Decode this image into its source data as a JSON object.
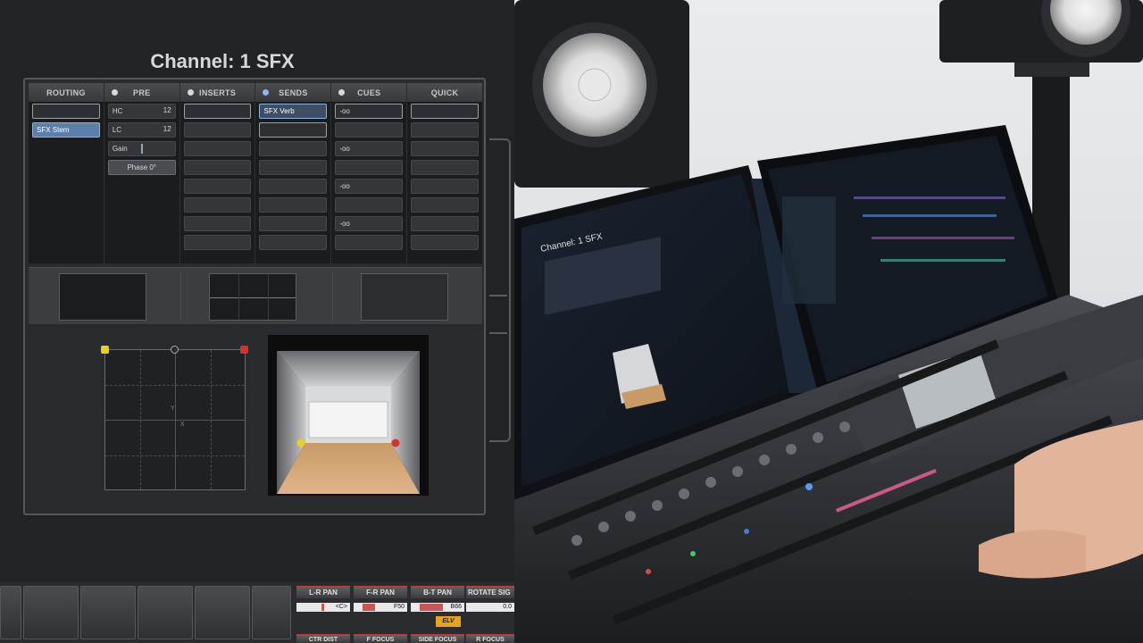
{
  "channel": {
    "title": "Channel: 1 SFX"
  },
  "tabs": [
    {
      "label": "ROUTING",
      "dot": "none"
    },
    {
      "label": "PRE",
      "dot": "white"
    },
    {
      "label": "INSERTS",
      "dot": "white"
    },
    {
      "label": "SENDS",
      "dot": "blue"
    },
    {
      "label": "CUES",
      "dot": "white"
    },
    {
      "label": "QUICK",
      "dot": "none"
    }
  ],
  "routing": {
    "output": "SFX Stem"
  },
  "pre": {
    "hc_label": "HC",
    "hc_value": "12",
    "lc_label": "LC",
    "lc_value": "12",
    "gain_label": "Gain",
    "phase_label": "Phase 0°"
  },
  "sends": {
    "send1": "SFX Verb"
  },
  "cues": {
    "values": [
      "-oo",
      "-oo",
      "-oo",
      "-oo"
    ]
  },
  "panner": {
    "x_label": "X",
    "y_label": "Y"
  },
  "bottom": {
    "lr_pan": "L-R PAN",
    "lr_value": "<C>",
    "fr_pan": "F-R PAN",
    "fr_value": "F50",
    "bt_pan": "B-T PAN",
    "bt_value": "B66",
    "rotate": "ROTATE SIG",
    "rotate_value": "0.0",
    "elv": "ELV",
    "ctr_dist": "CTR DIST",
    "f_focus": "F FOCUS",
    "side_focus": "SIDE FOCUS",
    "r_focus": "R FOCUS"
  },
  "colors": {
    "accent_blue": "#8fb7e8",
    "pan_yellow": "#e8d020",
    "pan_red": "#d83030",
    "elv": "#e8a318"
  }
}
